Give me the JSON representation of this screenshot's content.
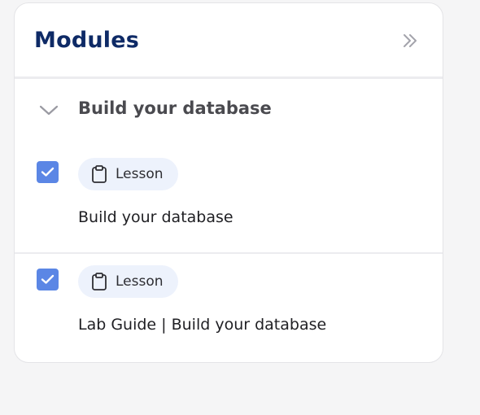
{
  "panel": {
    "title": "Modules",
    "collapse_icon": "double-chevron-right-icon"
  },
  "section": {
    "title": "Build your database",
    "expanded": true,
    "chevron_icon": "chevron-down-icon"
  },
  "items": [
    {
      "checked": true,
      "badge_icon": "clipboard-icon",
      "badge_label": "Lesson",
      "title": "Build your database"
    },
    {
      "checked": true,
      "badge_icon": "clipboard-icon",
      "badge_label": "Lesson",
      "title": "Lab Guide | Build your database"
    }
  ],
  "colors": {
    "title": "#0e2a66",
    "checkbox": "#5b86e5",
    "badge_bg": "#edf2fc"
  }
}
